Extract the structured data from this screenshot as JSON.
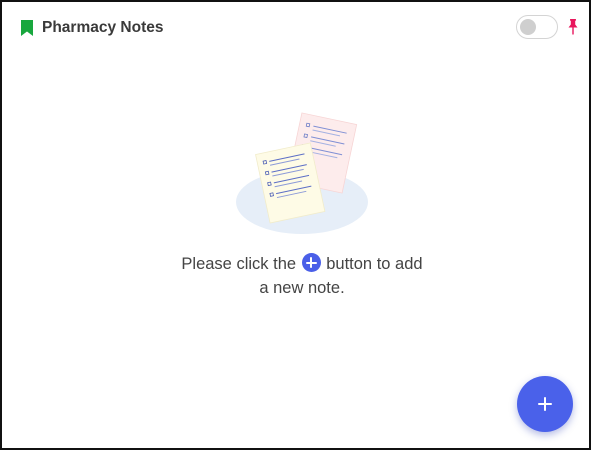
{
  "header": {
    "title": "Pharmacy Notes",
    "toggle_state": "off",
    "icons": {
      "left": "bookmark-icon",
      "right": "pin-icon"
    },
    "colors": {
      "bookmark": "#18a73e",
      "pin": "#e8175d",
      "title": "#3a3a3a"
    }
  },
  "empty_state": {
    "line1_before": "Please click the",
    "line1_after": "button to add",
    "line2": "a new note.",
    "inline_icon": "plus-circle-icon",
    "illustration": "notes-illustration"
  },
  "fab": {
    "icon": "plus-icon",
    "color": "#4a61ea"
  }
}
